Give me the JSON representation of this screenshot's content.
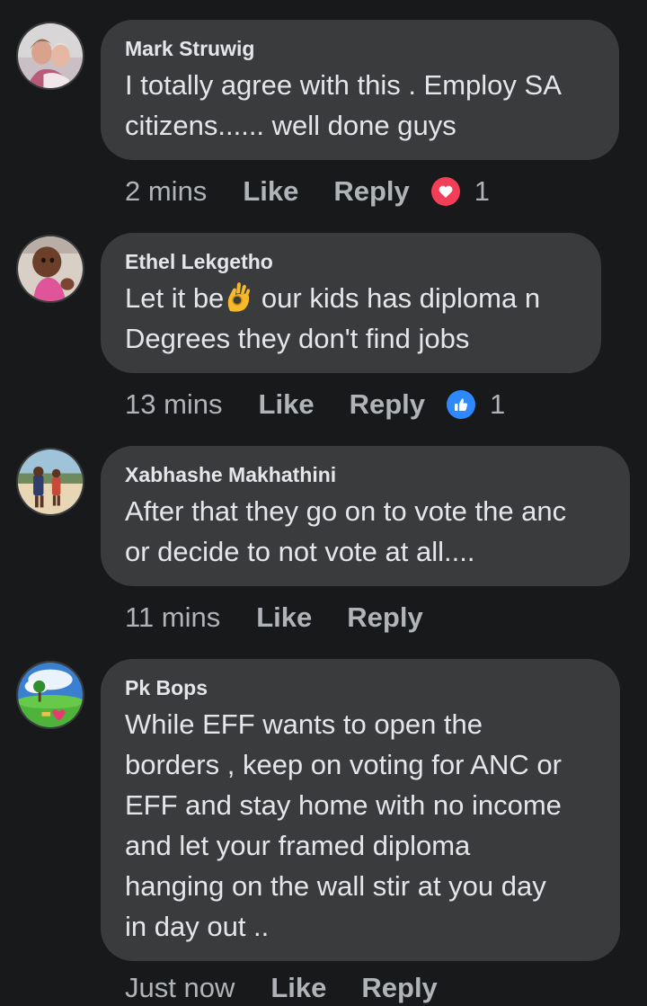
{
  "comments": [
    {
      "author": "Mark Struwig",
      "text_lines": [
        "I totally agree with this . Employ SA",
        "citizens...... well done guys"
      ],
      "time": "2 mins",
      "like_label": "Like",
      "reply_label": "Reply",
      "reaction": {
        "icon": "love-reaction-icon",
        "count": "1",
        "color": "#f33e58"
      }
    },
    {
      "author": "Ethel Lekgetho",
      "text_before_emoji": "Let it be",
      "emoji": "ok-hand-emoji",
      "text_after_emoji": " our kids has diploma n",
      "text_line2": "Degrees they don't find jobs",
      "time": "13 mins",
      "like_label": "Like",
      "reply_label": "Reply",
      "reaction": {
        "icon": "like-reaction-icon",
        "count": "1",
        "color": "#2e89ff"
      }
    },
    {
      "author": "Xabhashe Makhathini",
      "text_lines": [
        "After that they go on to vote the anc",
        "or decide to not vote at all...."
      ],
      "time": "11 mins",
      "like_label": "Like",
      "reply_label": "Reply"
    },
    {
      "author": "Pk Bops",
      "text_lines": [
        "While EFF wants to open the",
        "borders , keep on voting for ANC or",
        "EFF and stay home with no income",
        "and let your framed diploma",
        "hanging on the wall stir at you day",
        "in day out .."
      ],
      "time": "Just now",
      "like_label": "Like",
      "reply_label": "Reply"
    }
  ],
  "colors": {
    "background": "#18191a",
    "bubble": "#3a3b3c",
    "primary_text": "#e4e6eb",
    "secondary_text": "#b0b3b8"
  }
}
